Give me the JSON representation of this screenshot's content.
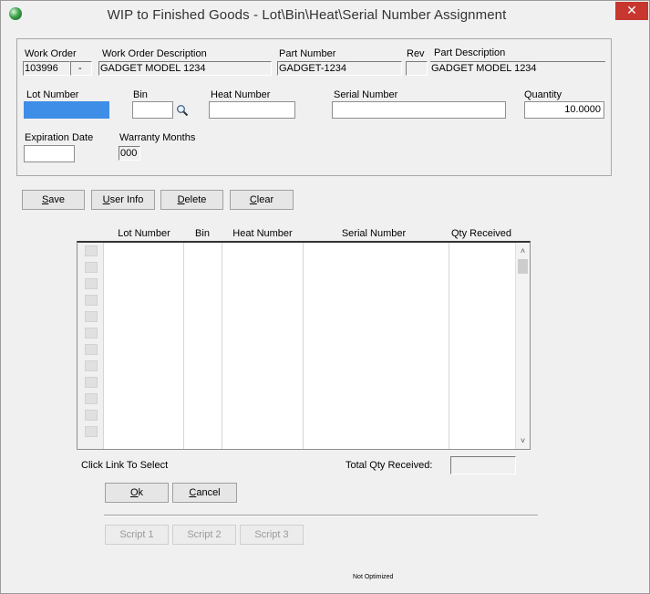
{
  "window": {
    "title": "WIP to Finished Goods - Lot\\Bin\\Heat\\Serial Number Assignment",
    "close_label": "✕"
  },
  "header": {
    "work_order_label": "Work Order",
    "work_order_value": "103996",
    "work_order_suffix": "-",
    "wo_description_label": "Work Order Description",
    "wo_description_value": "GADGET MODEL 1234",
    "part_number_label": "Part Number",
    "part_number_value": "GADGET-1234",
    "rev_label": "Rev",
    "rev_value": "",
    "part_description_label": "Part Description",
    "part_description_value": "GADGET MODEL 1234"
  },
  "entry": {
    "lot_number_label": "Lot Number",
    "lot_number_value": "",
    "bin_label": "Bin",
    "bin_value": "",
    "heat_number_label": "Heat Number",
    "heat_number_value": "",
    "serial_number_label": "Serial Number",
    "serial_number_value": "",
    "quantity_label": "Quantity",
    "quantity_value": "10.0000",
    "expiration_date_label": "Expiration Date",
    "expiration_date_value": "",
    "warranty_months_label": "Warranty Months",
    "warranty_months_value": "000"
  },
  "actions": {
    "save_u": "S",
    "save_rest": "ave",
    "user_info_u": "U",
    "user_info_rest": "ser Info",
    "delete_u": "D",
    "delete_rest": "elete",
    "clear_u": "C",
    "clear_rest": "lear"
  },
  "grid": {
    "columns": [
      "Lot Number",
      "Bin",
      "Heat Number",
      "Serial Number",
      "Qty Received"
    ],
    "rows": [],
    "scroll_up": "˄",
    "scroll_down": "˅"
  },
  "footer": {
    "click_link_text": "Click Link To Select",
    "total_qty_label": "Total Qty Received:",
    "total_qty_value": "",
    "ok_u": "O",
    "ok_rest": "k",
    "cancel_u": "C",
    "cancel_rest": "ancel",
    "script_buttons": [
      "Script 1",
      "Script 2",
      "Script 3"
    ],
    "status_text": "Not Optimized"
  },
  "colors": {
    "active_field": "#3e8ee8",
    "close_button": "#c7372f"
  }
}
